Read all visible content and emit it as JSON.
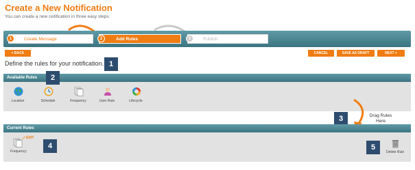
{
  "header": {
    "title": "Create a New Notification",
    "subtitle": "You can create a new notification in three easy steps."
  },
  "steps": [
    {
      "number": "1",
      "label": "Create Message"
    },
    {
      "number": "2",
      "label": "Add Rules"
    },
    {
      "number": "3",
      "label": "Publish"
    }
  ],
  "nav": {
    "back": "< BACK",
    "cancel": "CANCEL",
    "save_draft": "SAVE AS DRAFT",
    "next": "NEXT >"
  },
  "instructions": "Define the rules for your notification.",
  "markers": [
    "1",
    "2",
    "3",
    "4",
    "5"
  ],
  "available_rules": {
    "title": "Available Rules",
    "items": [
      {
        "label": "Location",
        "icon": "globe-icon"
      },
      {
        "label": "Schedule",
        "icon": "clock-icon"
      },
      {
        "label": "Frequency",
        "icon": "pages-icon"
      },
      {
        "label": "User Rule",
        "icon": "user-icon"
      },
      {
        "label": "Lifecycle",
        "icon": "cycle-icon"
      }
    ]
  },
  "drag_hint": "Drag Rules Here",
  "current_rules": {
    "title": "Current Rules",
    "items": [
      {
        "label": "Frequency",
        "icon": "pages-icon",
        "edit_label": "EDIT"
      }
    ],
    "delete_label": "Delete Rule"
  },
  "colors": {
    "accent": "#f07c13",
    "bar": "#4a8794",
    "marker": "#2e4d6e",
    "panel": "#e2e2e2"
  }
}
